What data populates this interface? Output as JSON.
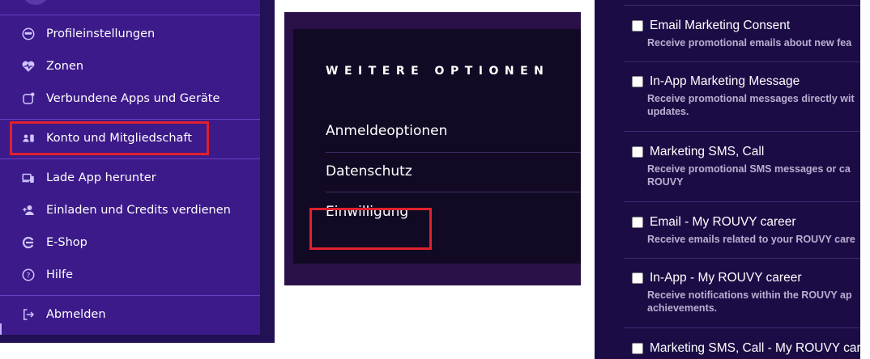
{
  "sidebar": {
    "items": [
      {
        "label": "Profileinstellungen",
        "icon": "user-helmet-icon"
      },
      {
        "label": "Zonen",
        "icon": "heart-pulse-icon"
      },
      {
        "label": "Verbundene Apps und Geräte",
        "icon": "connected-device-icon"
      },
      {
        "label": "Konto und Mitgliedschaft",
        "icon": "id-card-icon"
      },
      {
        "label": "Lade App herunter",
        "icon": "devices-icon"
      },
      {
        "label": "Einladen und Credits verdienen",
        "icon": "add-user-icon"
      },
      {
        "label": "E-Shop",
        "icon": "shop-logo-icon"
      },
      {
        "label": "Hilfe",
        "icon": "help-circle-icon"
      },
      {
        "label": "Abmelden",
        "icon": "logout-icon"
      }
    ]
  },
  "options": {
    "heading": "WEITERE OPTIONEN",
    "items": [
      "Anmeldeoptionen",
      "Datenschutz",
      "Einwilligung"
    ]
  },
  "consents": [
    {
      "title": "Email Marketing Consent",
      "desc": "Receive promotional emails about new fea"
    },
    {
      "title": "In-App Marketing Message",
      "desc": "Receive promotional messages directly wit\nupdates."
    },
    {
      "title": "Marketing SMS, Call",
      "desc": "Receive promotional SMS messages or ca\nROUVY"
    },
    {
      "title": "Email - My ROUVY career",
      "desc": "Receive emails related to your ROUVY care"
    },
    {
      "title": "In-App - My ROUVY career",
      "desc": "Receive notifications within the ROUVY ap\nachievements."
    },
    {
      "title": "Marketing SMS, Call - My ROUVY career",
      "desc": ""
    }
  ],
  "colors": {
    "highlight": "#e0202c",
    "sidebar_bg": "#3c1a8a",
    "options_bg": "#120a24",
    "consent_bg": "#1c0c46"
  }
}
